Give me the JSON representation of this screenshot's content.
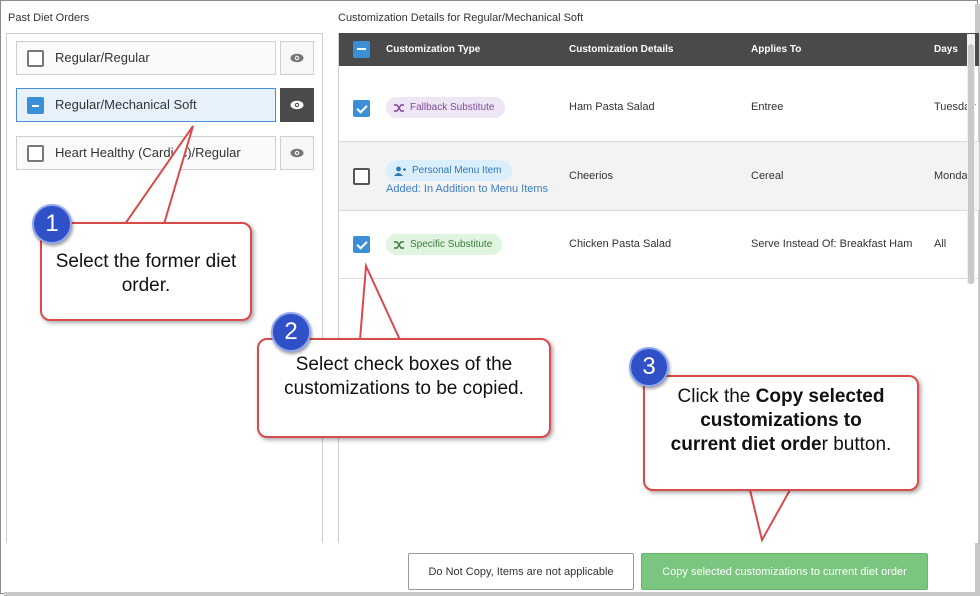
{
  "left": {
    "title": "Past Diet Orders",
    "orders": [
      {
        "label": "Regular/Regular",
        "state": "unchecked"
      },
      {
        "label": "Regular/Mechanical Soft",
        "state": "selected"
      },
      {
        "label": "Heart Healthy (Cardiac)/Regular",
        "state": "unchecked"
      }
    ]
  },
  "right": {
    "title": "Customization Details for Regular/Mechanical Soft",
    "headers": {
      "type": "Customization Type",
      "details": "Customization Details",
      "applies": "Applies To",
      "days": "Days"
    },
    "rows": [
      {
        "checked": true,
        "type": "Fallback Substitute",
        "type_icon": "shuffle-icon",
        "type_color": "#7b4c9a",
        "sub": "",
        "details": "Ham Pasta Salad",
        "applies": "Entree",
        "days": "Tuesday"
      },
      {
        "checked": false,
        "type": "Personal Menu Item",
        "type_icon": "user-add-icon",
        "type_color": "#2f77b8",
        "sub": "Added: In Addition to Menu Items",
        "details": "Cheerios",
        "applies": "Cereal",
        "days": "Monday,"
      },
      {
        "checked": true,
        "type": "Specific Substitute",
        "type_icon": "shuffle-icon",
        "type_color": "#3d7a3d",
        "sub": "",
        "details": "Chicken Pasta Salad",
        "applies": "Serve Instead Of: Breakfast Ham",
        "days": "All"
      }
    ]
  },
  "buttons": {
    "no_copy": "Do Not Copy, Items are not applicable",
    "copy": "Copy selected customizations to current diet order"
  },
  "callouts": [
    {
      "number": "1",
      "text": "Select the former diet order."
    },
    {
      "number": "2",
      "text": "Select check boxes of the customizations to be copied."
    },
    {
      "number": "3",
      "pre": "Click the ",
      "bold": "Copy selected customizations to current diet orde",
      "post": "r button."
    }
  ],
  "colors": {
    "header_bg": "#4a4a4a",
    "accent_blue": "#3a8fd6",
    "copy_button": "#7bc67e",
    "callout_border": "#d94b4b",
    "badge_blue": "#3050c8"
  }
}
